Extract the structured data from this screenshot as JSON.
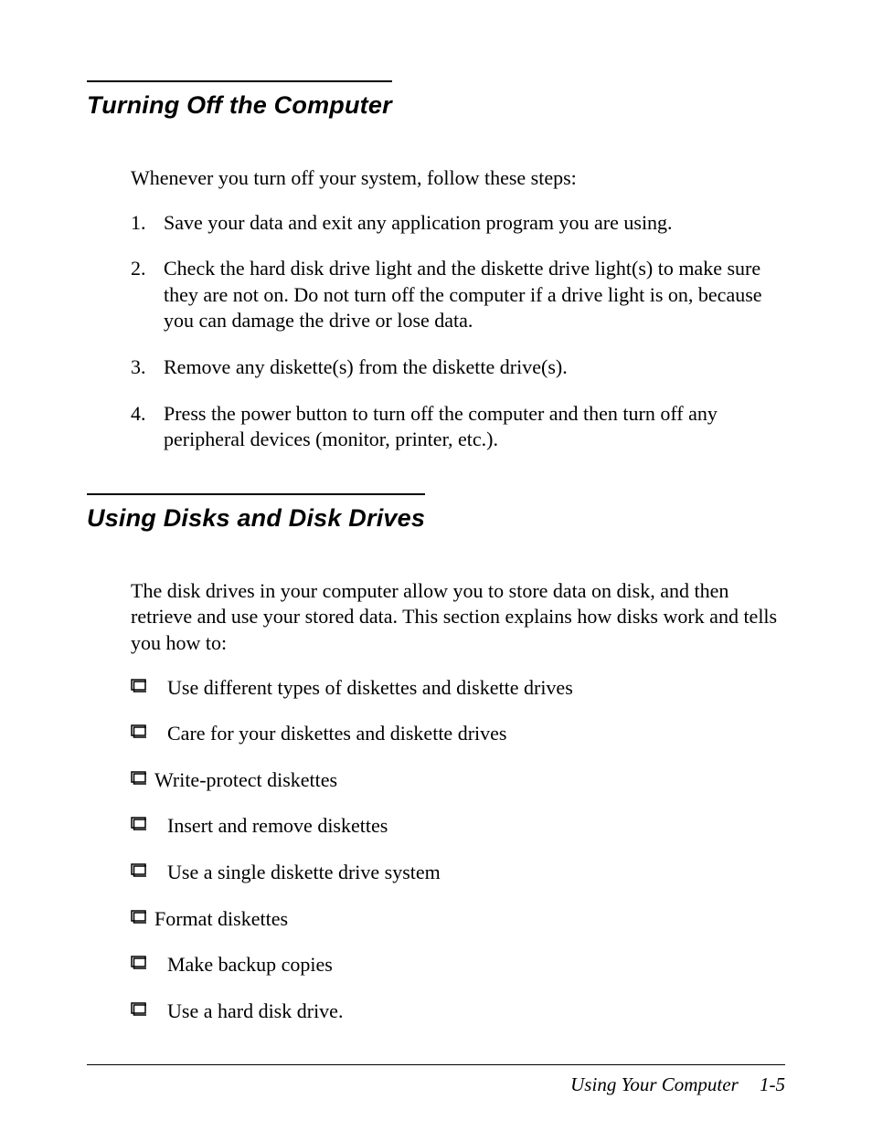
{
  "section1": {
    "heading": "Turning Off the Computer",
    "intro": "Whenever you turn off your system, follow these steps:",
    "steps": [
      {
        "num": "1.",
        "text": "Save your data and exit any application program you are using."
      },
      {
        "num": "2.",
        "text": "Check the hard disk drive light and the diskette drive light(s) to make sure they are not on. Do not turn off the computer if a drive light is on, because you can damage the drive or lose data."
      },
      {
        "num": "3.",
        "text": "Remove any diskette(s) from the diskette drive(s)."
      },
      {
        "num": "4.",
        "text": "Press the power button to turn off the computer and then turn off any peripheral devices (monitor, printer, etc.)."
      }
    ]
  },
  "section2": {
    "heading": "Using Disks and Disk Drives",
    "intro": "The disk drives in your computer allow you to store data on disk, and then retrieve and use your stored data. This section explains how disks work and tells you how to:",
    "bullets": [
      {
        "text": "Use different types of diskettes and diskette drives",
        "tight": false
      },
      {
        "text": "Care for your diskettes and diskette drives",
        "tight": false
      },
      {
        "text": "Write-protect diskettes",
        "tight": true
      },
      {
        "text": "Insert and remove diskettes",
        "tight": false
      },
      {
        "text": "Use a single diskette drive system",
        "tight": false
      },
      {
        "text": "Format diskettes",
        "tight": true
      },
      {
        "text": "Make backup copies",
        "tight": false
      },
      {
        "text": "Use a hard disk drive.",
        "tight": false
      }
    ]
  },
  "footer": {
    "chapter": "Using Your Computer",
    "page": "1-5"
  }
}
